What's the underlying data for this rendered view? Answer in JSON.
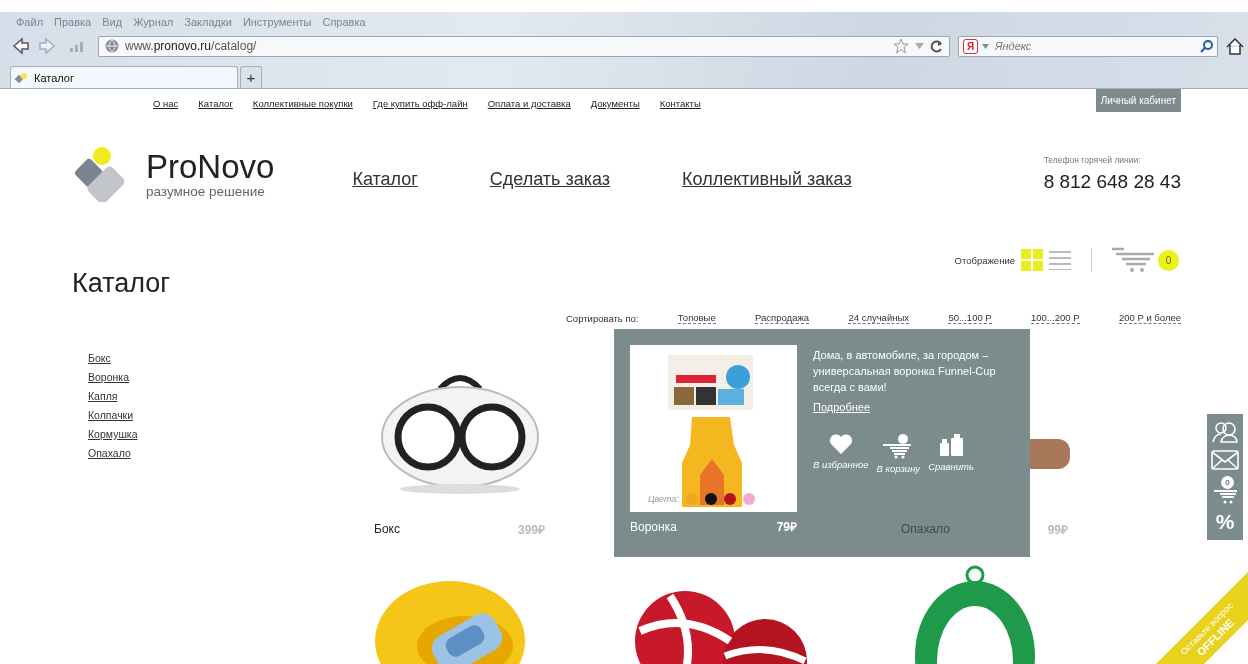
{
  "browser": {
    "menu": [
      "Файл",
      "Правка",
      "Вид",
      "Журнал",
      "Закладки",
      "Инструменты",
      "Справка"
    ],
    "address": "www.**pronovo.ru**/catalog/",
    "search": {
      "engine_logo": "Я",
      "placeholder": "Яндекс"
    },
    "tabs": [
      {
        "label": "Каталог",
        "selected": true
      }
    ],
    "new_tab": "+"
  },
  "top_links": [
    "О нас",
    "Каталог",
    "Коллективные покупки",
    "Где купить офф-лайн",
    "Оплата и доставка",
    "Документы",
    "Контакты"
  ],
  "account_button": "Личный кабинет",
  "logo": {
    "name": "ProNovo",
    "tagline": "разумное решение"
  },
  "main_nav": [
    "Каталог",
    "Сделать заказ",
    "Коллективный заказ"
  ],
  "hotline": {
    "label": "Телефон горячей линии:",
    "phone": "8 812 648 28 43"
  },
  "page_title": "Каталог",
  "view": {
    "label": "Отображение",
    "options": [
      {
        "kind": "grid",
        "selected": true
      },
      {
        "kind": "list",
        "selected": false
      }
    ]
  },
  "cart": {
    "count": "0"
  },
  "sort": {
    "label": "Сортировать по:",
    "options": [
      "Топовые",
      "Распродажа",
      "24 случайных",
      "50...100 Р",
      "100...200 Р",
      "200 Р и более"
    ]
  },
  "categories": [
    "Бокс",
    "Воронка",
    "Капля",
    "Колпачки",
    "Кормушка",
    "Опахало"
  ],
  "products": [
    {
      "kind": "product",
      "name": "Бокс",
      "price": "399₽",
      "hovered": false
    },
    {
      "kind": "product",
      "name": "Воронка",
      "price": "79₽",
      "hovered": true
    },
    {
      "kind": "product",
      "name": "Опахало",
      "price": "99₽",
      "hovered": false
    },
    {
      "kind": "picture"
    },
    {
      "kind": "picture"
    },
    {
      "kind": "picture"
    }
  ],
  "popover": {
    "description": "Дома, в автомобиле, за городом  – универсальная воронка Funnel-Cup всегда с вами!",
    "more_link": "Подробнее",
    "colors_label": "Цвета:",
    "colors": [
      {
        "color": "#f0a521"
      },
      {
        "color": "#111111"
      },
      {
        "color": "#b3151a"
      },
      {
        "color": "#f5a8d4"
      }
    ],
    "actions": [
      {
        "kind": "favorite",
        "label": "В избранное"
      },
      {
        "kind": "cart",
        "label": "В корзину"
      },
      {
        "kind": "compare",
        "label": "Сравнить"
      }
    ]
  },
  "side_panel": {
    "cart_count": "0",
    "discount": "%"
  },
  "ribbon": {
    "line1": "Оставьте вопрос",
    "line2": "OFFLINE"
  }
}
